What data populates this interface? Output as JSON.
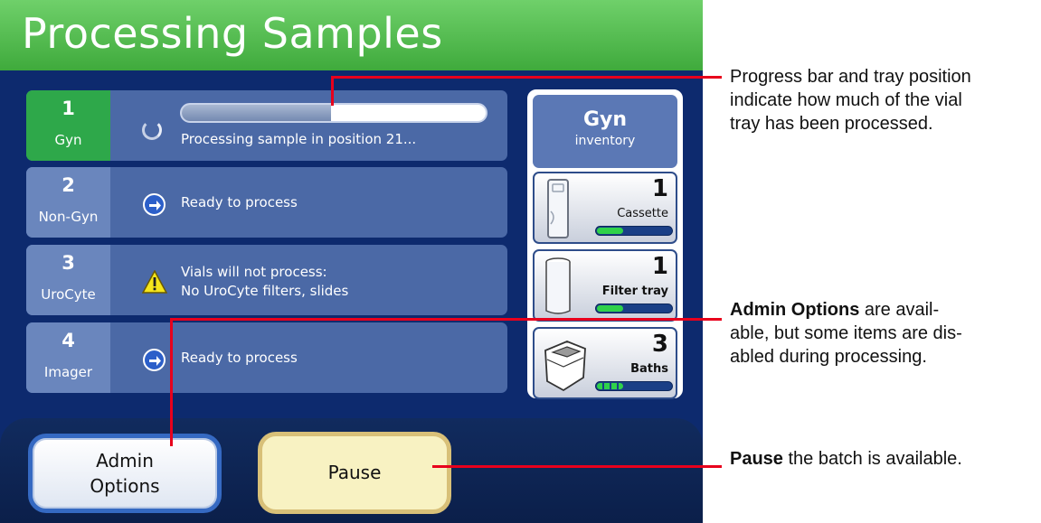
{
  "header": {
    "title": "Processing Samples"
  },
  "rows": [
    {
      "number": "1",
      "name": "Gyn",
      "status": "Processing sample in position 21...",
      "state": "processing",
      "progress": 0.49
    },
    {
      "number": "2",
      "name": "Non-Gyn",
      "status": "Ready to process",
      "state": "ready"
    },
    {
      "number": "3",
      "name": "UroCyte",
      "status_line1": "Vials will not process:",
      "status_line2": "No UroCyte filters, slides",
      "state": "warning"
    },
    {
      "number": "4",
      "name": "Imager",
      "status": "Ready to process",
      "state": "ready"
    }
  ],
  "inventory": {
    "title": "Gyn",
    "subtitle": "inventory",
    "items": [
      {
        "count": "1",
        "label": "Cassette",
        "level": 0.35,
        "icon": "cassette-icon"
      },
      {
        "count": "1",
        "label": "Filter tray",
        "level": 0.35,
        "icon": "filter-tray-icon"
      },
      {
        "count": "3",
        "label": "Baths",
        "level": 0.35,
        "icon": "bath-icon"
      }
    ]
  },
  "buttons": {
    "admin_line1": "Admin",
    "admin_line2": "Options",
    "pause": "Pause"
  },
  "callouts": {
    "progress": {
      "line1": "Progress bar and tray position",
      "line2": "indicate how much of the vial",
      "line3": "tray has been processed."
    },
    "admin": {
      "bold": "Admin Options",
      "line1_rest": " are avail-",
      "line2": "able, but some items are dis-",
      "line3": "abled during processing."
    },
    "pause": {
      "bold": "Pause",
      "rest": " the batch is available."
    }
  },
  "colors": {
    "header_green": "#3faa3c",
    "active_green": "#2ea84a",
    "row_blue": "#4b69a6",
    "callout_red": "#e8001c",
    "meter_green": "#2fd14a"
  }
}
